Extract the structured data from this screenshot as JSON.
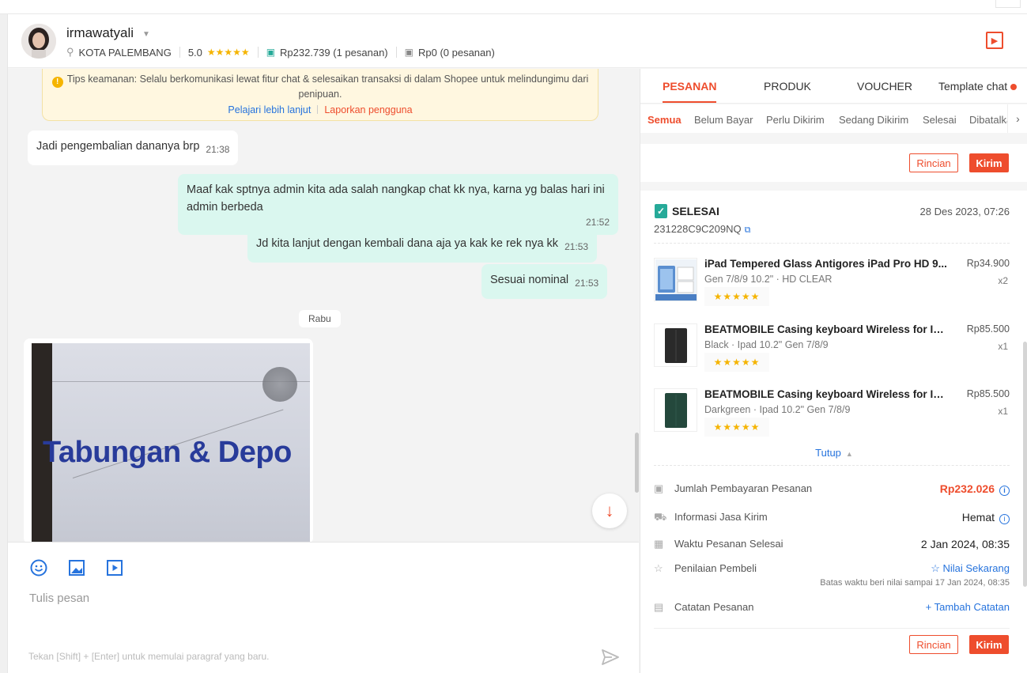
{
  "header": {
    "username": "irmawatyali",
    "location": "KOTA PALEMBANG",
    "rating": "5.0",
    "stars": "★★★★★",
    "completed_orders": "Rp232.739 (1 pesanan)",
    "cancelled_orders": "Rp0 (0 pesanan)"
  },
  "tips": {
    "text": "Tips keamanan: Selalu berkomunikasi lewat fitur chat & selesaikan transaksi di dalam Shopee untuk melindungimu dari penipuan.",
    "learn_more": "Pelajari lebih lanjut",
    "report": "Laporkan pengguna"
  },
  "messages": [
    {
      "text": "Jadi pengembalian dananya brp",
      "time": "21:38",
      "from": "buyer"
    },
    {
      "text": "Maaf kak sptnya admin kita ada salah nangkap chat kk nya, karna yg balas hari ini admin berbeda",
      "time": "21:52",
      "from": "seller"
    },
    {
      "text": "Jd kita lanjut dengan kembali dana aja ya kak ke rek nya kk",
      "time": "21:53",
      "from": "seller"
    },
    {
      "text": "Sesuai nominal",
      "time": "21:53",
      "from": "seller"
    }
  ],
  "date_chip": "Rabu",
  "photo": {
    "text": "Tabungan & Depo"
  },
  "composer": {
    "placeholder": "Tulis pesan",
    "hint": "Tekan [Shift] + [Enter] untuk memulai paragraf yang baru."
  },
  "panel": {
    "tabs": [
      "PESANAN",
      "PRODUK",
      "VOUCHER",
      "Template chat"
    ],
    "subtabs": [
      "Semua",
      "Belum Bayar",
      "Perlu Dikirim",
      "Sedang Dikirim",
      "Selesai",
      "Dibatalkan"
    ],
    "rincian": "Rincian",
    "kirim": "Kirim",
    "order": {
      "status": "SELESAI",
      "date": "28 Des 2023, 07:26",
      "id": "231228C9C209NQ",
      "items": [
        {
          "name": "iPad Tempered Glass Antigores iPad Pro HD 9...",
          "variant": "Gen 7/8/9 10.2\" · HD CLEAR",
          "price": "Rp34.900",
          "qty": "x2",
          "rating": "★★★★★"
        },
        {
          "name": "BEATMOBILE Casing keyboard Wireless for IPa...",
          "variant": "Black · Ipad 10.2\" Gen 7/8/9",
          "price": "Rp85.500",
          "qty": "x1",
          "rating": "★★★★★"
        },
        {
          "name": "BEATMOBILE Casing keyboard Wireless for IPa...",
          "variant": "Darkgreen · Ipad 10.2\" Gen 7/8/9",
          "price": "Rp85.500",
          "qty": "x1",
          "rating": "★★★★★"
        }
      ],
      "collapse": "Tutup",
      "payment_label": "Jumlah Pembayaran Pesanan",
      "payment_value": "Rp232.026",
      "shipping_label": "Informasi Jasa Kirim",
      "shipping_value": "Hemat",
      "completed_label": "Waktu Pesanan Selesai",
      "completed_value": "2 Jan 2024, 08:35",
      "review_label": "Penilaian Pembeli",
      "review_value": "☆ Nilai Sekarang",
      "review_deadline": "Batas waktu beri nilai sampai 17 Jan 2024, 08:35",
      "note_label": "Catatan Pesanan",
      "note_value": "+ Tambah Catatan"
    }
  },
  "colors": {
    "brand": "#ee4d2d",
    "link": "#2673dd",
    "bubble_out": "#daf7ef",
    "success": "#26aa99"
  }
}
